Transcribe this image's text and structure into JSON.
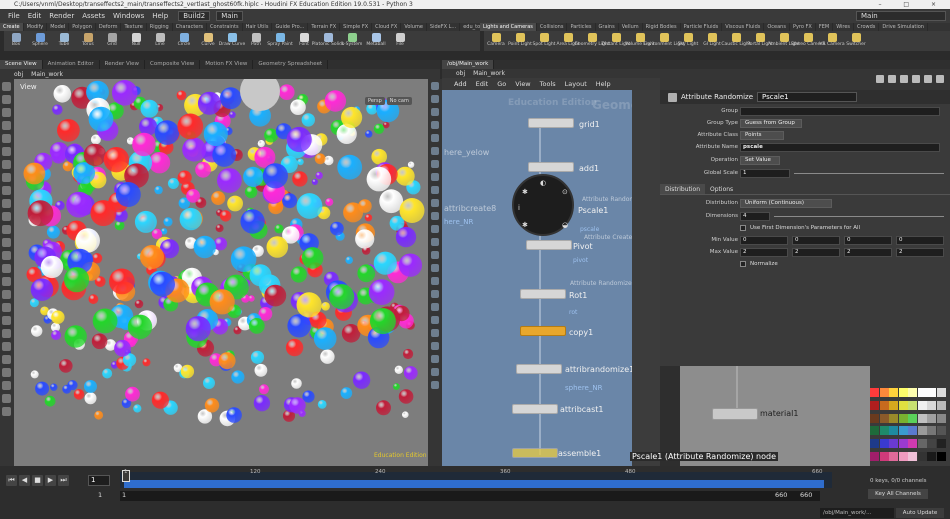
{
  "window": {
    "title": "C:/Users/vnml/Desktop/transeffects2_main/transeffects2_vertlast_ghost60fk.hiplc - Houdini FX Education Edition 19.0.531 - Python 3",
    "controls": "– □ ×"
  },
  "menu": {
    "items": [
      "File",
      "Edit",
      "Render",
      "Assets",
      "Windows",
      "Help"
    ],
    "desktop": "Build2",
    "context": "Main",
    "right_context": "Main"
  },
  "shelf_left": {
    "tabs": [
      "Create",
      "Modify",
      "Model",
      "Polygon",
      "Deform",
      "Texture",
      "Rigging",
      "Characters",
      "Constraints",
      "Hair Utils",
      "Guide Pro...",
      "Terrain FX",
      "Simple FX",
      "Cloud FX",
      "Volume",
      "SideFX L...",
      "edu_toolset"
    ],
    "tools": [
      "Box",
      "Sphere",
      "Tube",
      "Torus",
      "Grid",
      "Null",
      "Line",
      "Circle",
      "Curve",
      "Draw Curve",
      "Path",
      "Spray Paint",
      "Font",
      "Platonic Solids",
      "L-System",
      "Metaball",
      "File"
    ]
  },
  "shelf_right": {
    "tabs": [
      "Lights and Cameras",
      "Collisions",
      "Particles",
      "Grains",
      "Vellum",
      "Rigid Bodies",
      "Particle Fluids",
      "Viscous Fluids",
      "Oceans",
      "Pyro FX",
      "FEM",
      "Wires",
      "Crowds",
      "Drive Simulation"
    ],
    "tools": [
      "Camera",
      "Point Light",
      "Spot Light",
      "Area Light",
      "Geometry Light",
      "Distant Light",
      "Volume Light",
      "Environment Light",
      "Sky Light",
      "GI Light",
      "Caustic Light",
      "Portal Light",
      "Ambient Light",
      "Stereo Camera",
      "VR Camera",
      "Switcher"
    ]
  },
  "viewer": {
    "tabs": [
      "Scene View",
      "Animation Editor",
      "Render View",
      "Composite View",
      "Motion FX View",
      "Geometry Spreadsheet"
    ],
    "path": [
      "obj",
      "Main_work"
    ],
    "label": "View",
    "persp": "Persp",
    "cam": "No cam",
    "watermark": "Education Edition"
  },
  "network": {
    "tab": "/obj/Main_work",
    "path": [
      "obj",
      "Main_work"
    ],
    "menu": [
      "Add",
      "Edit",
      "Go",
      "View",
      "Tools",
      "Layout",
      "Help"
    ],
    "watermark_geo": "Geometry",
    "watermark_edu": "Education Edition",
    "nodes": [
      {
        "label": "grid1"
      },
      {
        "label": "add1"
      },
      {
        "label": "Pscale1",
        "type": "Attribute Randomize"
      },
      {
        "label": "Pivot",
        "type": "Attribute Create",
        "sub": "pivot"
      },
      {
        "label": "Rot1",
        "type": "Attribute Randomize",
        "sub": "rot"
      },
      {
        "label": "copy1"
      },
      {
        "label": "attribrandomize1",
        "sub": "sphere_NR"
      },
      {
        "label": "attribcast1"
      },
      {
        "label": "assemble1"
      }
    ],
    "left_labels": [
      "here_yelow",
      "attribcreate8",
      "here_NR"
    ],
    "pscale_sub": "pscale",
    "radial_symbols": [
      "◐",
      "✱",
      "i",
      "✱",
      "⊙",
      "◒"
    ]
  },
  "parameters": {
    "node_type": "Attribute Randomize",
    "node_name": "Pscale1",
    "rows": [
      {
        "label": "Group",
        "value": ""
      },
      {
        "label": "Group Type",
        "value": "Guess from Group"
      },
      {
        "label": "Attribute Class",
        "value": "Points"
      },
      {
        "label": "Attribute Name",
        "value": "pscale"
      },
      {
        "label": "Operation",
        "value": "Set Value"
      },
      {
        "label": "Global Scale",
        "value": "1"
      }
    ],
    "tabs": [
      "Distribution",
      "Options"
    ],
    "distribution": {
      "label": "Distribution",
      "value": "Uniform (Continuous)"
    },
    "dimensions": {
      "label": "Dimensions",
      "value": "4"
    },
    "use_first": "Use First Dimension's Parameters for All",
    "min": {
      "label": "Min Value",
      "values": [
        "0",
        "0",
        "0",
        "0"
      ]
    },
    "max": {
      "label": "Max Value",
      "values": [
        "2",
        "2",
        "2",
        "2"
      ]
    },
    "normalize": "Normalize"
  },
  "lower_network": {
    "node": "material1"
  },
  "tooltip": "Pscale1 (Attribute Randomize) node",
  "timeline": {
    "frame": "1",
    "start": "1",
    "end": "660",
    "end2": "660",
    "range_start": "1",
    "range_start2": "1",
    "ticks": [
      "1",
      "120",
      "240",
      "360",
      "480",
      "660"
    ],
    "keys": "0 keys, 0/0 channels",
    "all_keys": "Key All Channels",
    "status_path": "/obj/Main_work/...",
    "auto_update": "Auto Update"
  },
  "colors": {
    "network_bg": "#6a86a8",
    "viewport_bg": "#7d7d7d",
    "timeline_fill": "#2f6dcd",
    "edu_yellow": "#e5c92b"
  }
}
